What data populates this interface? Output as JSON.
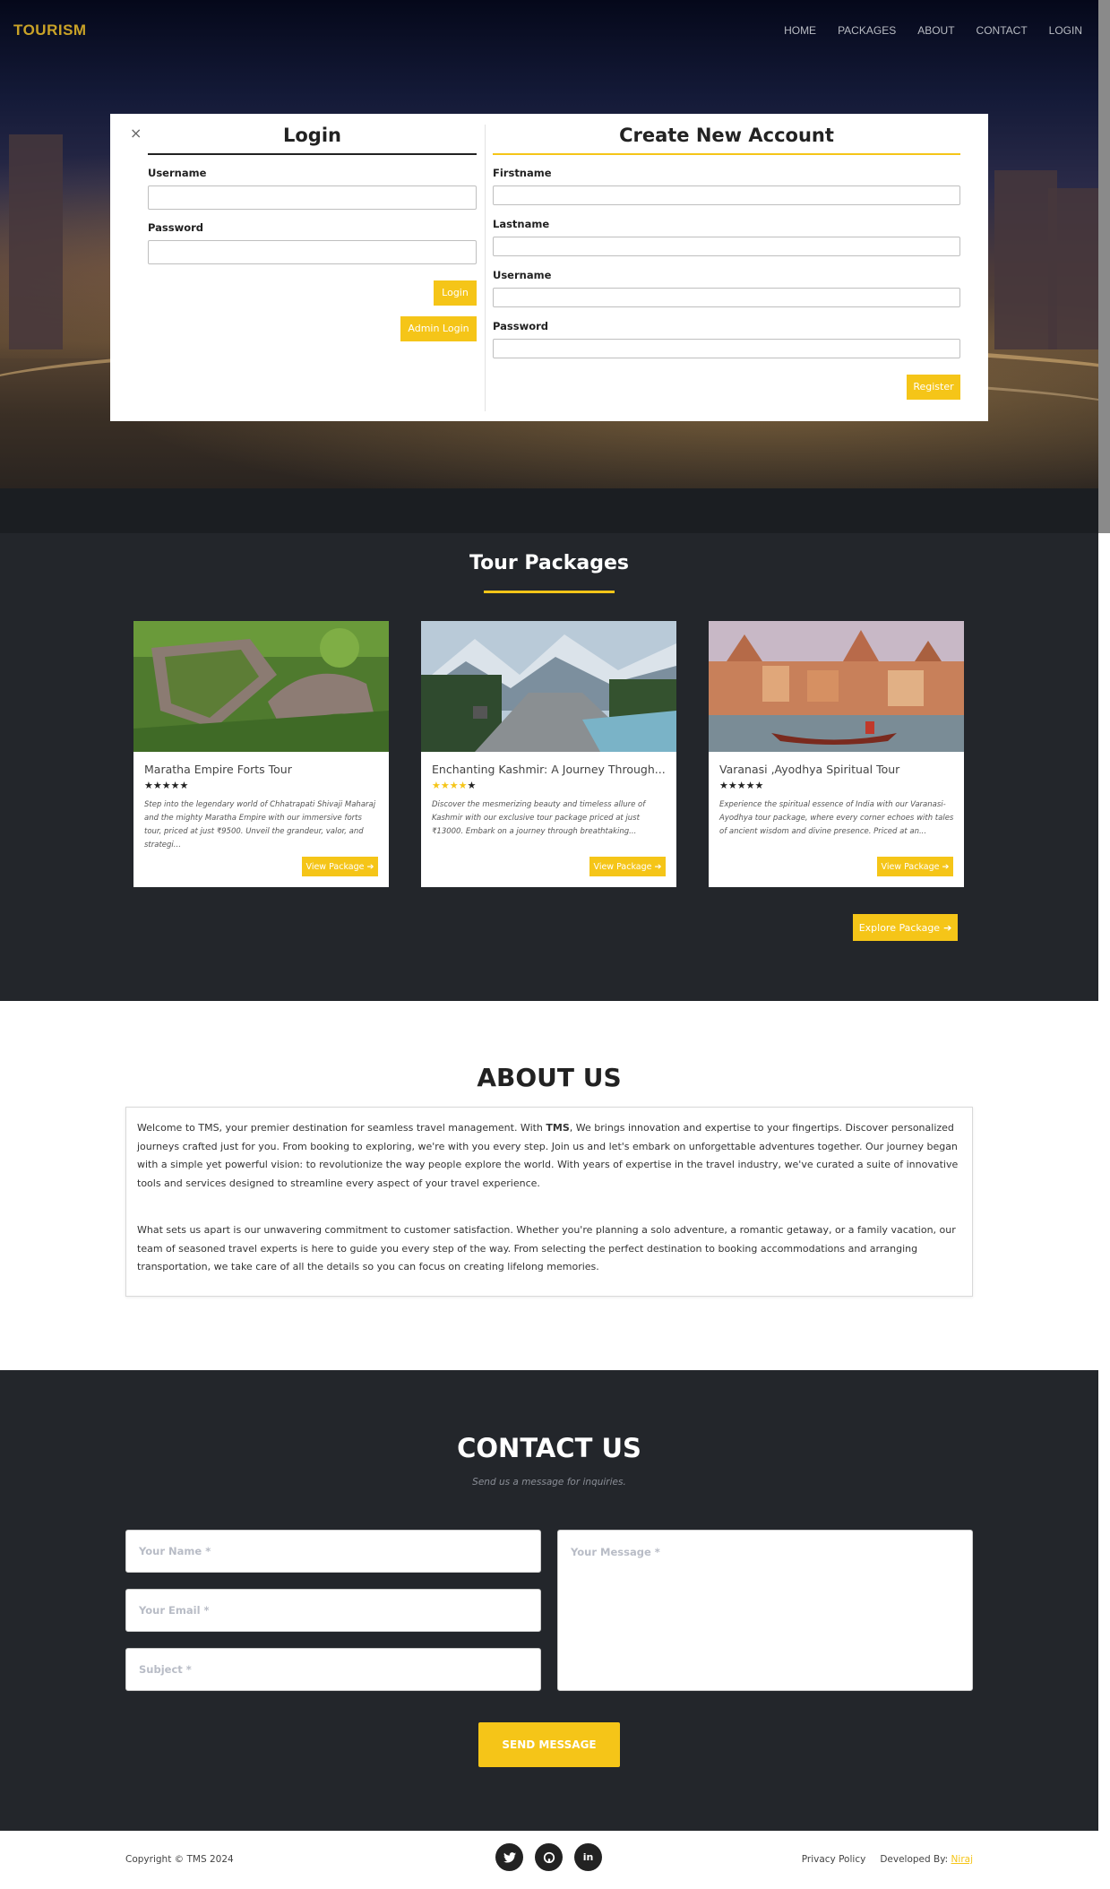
{
  "navbar": {
    "brand": "TOURISM",
    "links": [
      "HOME",
      "PACKAGES",
      "ABOUT",
      "CONTACT",
      "LOGIN"
    ]
  },
  "login": {
    "close": "×",
    "title": "Login",
    "username_label": "Username",
    "password_label": "Password",
    "login_button": "Login",
    "admin_button": "Admin Login"
  },
  "register": {
    "title": "Create New Account",
    "firstname_label": "Firstname",
    "lastname_label": "Lastname",
    "username_label": "Username",
    "password_label": "Password",
    "register_button": "Register"
  },
  "tours": {
    "title": "Tour Packages",
    "cards": [
      {
        "name": "Maratha Empire Forts Tour",
        "rating": 5,
        "description": "Step into the legendary world of Chhatrapati Shivaji Maharaj and the mighty Maratha Empire with our immersive forts tour, priced at just ₹9500. Unveil the grandeur, valor, and strategi...",
        "button": "View Package"
      },
      {
        "name": "Enchanting Kashmir: A Journey Through...",
        "rating": 4,
        "description": "Discover the mesmerizing beauty and timeless allure of Kashmir with our exclusive tour package priced at just ₹13000. Embark on a journey through breathtaking...",
        "button": "View Package"
      },
      {
        "name": "Varanasi ,Ayodhya Spiritual Tour",
        "rating": 5,
        "description": "Experience the spiritual essence of India with our Varanasi-Ayodhya tour package, where every corner echoes with tales of ancient wisdom and divine presence. Priced at an...",
        "button": "View Package"
      }
    ],
    "explore_button": "Explore Package"
  },
  "about": {
    "title": "ABOUT US",
    "p1_before": "Welcome to TMS, your premier destination for seamless travel management. With ",
    "p1_bold": "TMS",
    "p1_after": ", We brings innovation and expertise to your fingertips. Discover personalized journeys crafted just for you. From booking to exploring, we're with you every step. Join us and let's embark on unforgettable adventures together.  Our journey began with a simple yet powerful vision: to revolutionize the way people explore the world. With years of expertise in the travel industry, we've curated a suite of innovative tools and services designed to streamline every aspect of your travel experience.",
    "p2": "What sets us apart is our unwavering commitment to customer satisfaction. Whether you're planning a solo adventure, a romantic getaway, or a family vacation, our team of seasoned travel experts is here to guide you every step of the way. From selecting the perfect destination to booking accommodations and arranging transportation, we take care of all the details so you can focus on creating lifelong memories."
  },
  "contact": {
    "title": "CONTACT US",
    "subtitle": "Send us a message for inquiries.",
    "name_placeholder": "Your Name *",
    "email_placeholder": "Your Email *",
    "subject_placeholder": "Subject *",
    "message_placeholder": "Your Message *",
    "send_button": "SEND MESSAGE"
  },
  "footer": {
    "copyright": "Copyright © TMS 2024",
    "socials": [
      "twitter-icon",
      "github-icon",
      "linkedin-icon"
    ],
    "privacy": "Privacy Policy",
    "developed_by": "Developed By:",
    "developer": "Niraj"
  },
  "colors": {
    "accent": "#f5c518",
    "dark_section": "#23262b",
    "brand": "#c9a227"
  }
}
